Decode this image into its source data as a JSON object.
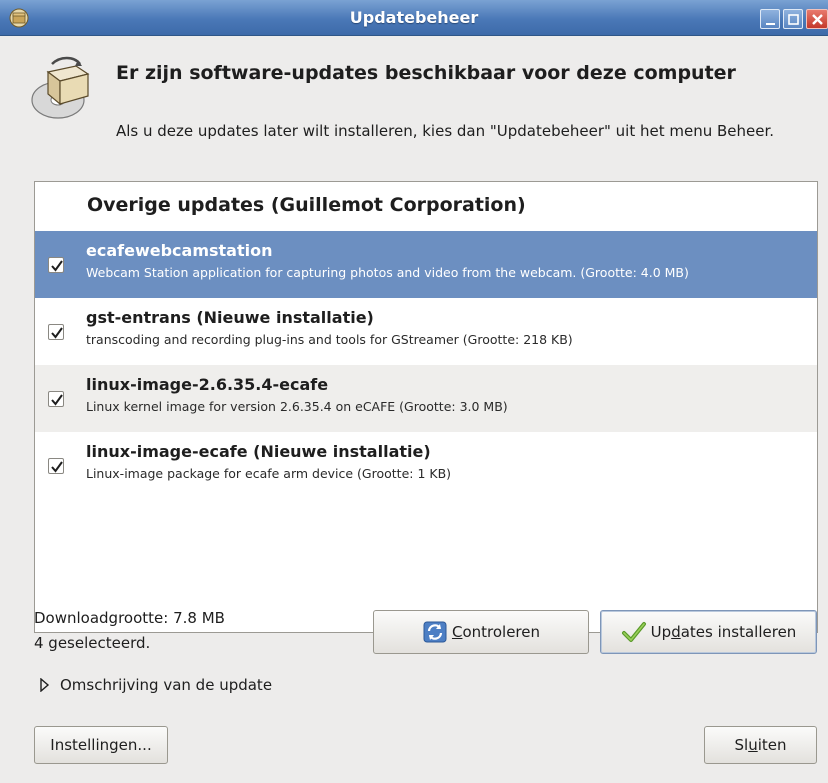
{
  "window": {
    "title": "Updatebeheer",
    "icon": "update-manager-icon"
  },
  "header": {
    "headline": "Er zijn software-updates beschikbaar voor deze computer",
    "subtext": "Als u deze updates later wilt installeren, kies dan \"Updatebeheer\" uit het menu Beheer.",
    "icon": "package-icon"
  },
  "updates": {
    "group_title": "Overige updates (Guillemot Corporation)",
    "items": [
      {
        "name": "ecafewebcamstation",
        "description": "Webcam Station application for capturing photos and video from the webcam. (Grootte: 4.0 MB)",
        "checked": true,
        "selected": true
      },
      {
        "name": "gst-entrans (Nieuwe installatie)",
        "description": "transcoding and recording plug-ins and tools for GStreamer (Grootte: 218 KB)",
        "checked": true,
        "selected": false
      },
      {
        "name": "linux-image-2.6.35.4-ecafe",
        "description": "Linux kernel image for version 2.6.35.4 on eCAFE (Grootte: 3.0 MB)",
        "checked": true,
        "selected": false
      },
      {
        "name": "linux-image-ecafe (Nieuwe installatie)",
        "description": "Linux-image package for ecafe arm device (Grootte: 1 KB)",
        "checked": true,
        "selected": false
      }
    ]
  },
  "footer": {
    "download_size": "Downloadgrootte: 7.8 MB",
    "selected_count": "4 geselecteerd.",
    "check_button": {
      "pre": "",
      "mnemonic": "C",
      "post": "ontroleren"
    },
    "install_button": {
      "pre": "Up",
      "mnemonic": "d",
      "post": "ates installeren"
    },
    "expander_label": "Omschrijving van de update",
    "settings_button": "Instellingen...",
    "close_button": {
      "pre": "Sl",
      "mnemonic": "u",
      "post": "iten"
    }
  },
  "colors": {
    "titlebar": "#4a78b7",
    "selection": "#6c8fc1",
    "dialog_bg": "#edeceb"
  }
}
